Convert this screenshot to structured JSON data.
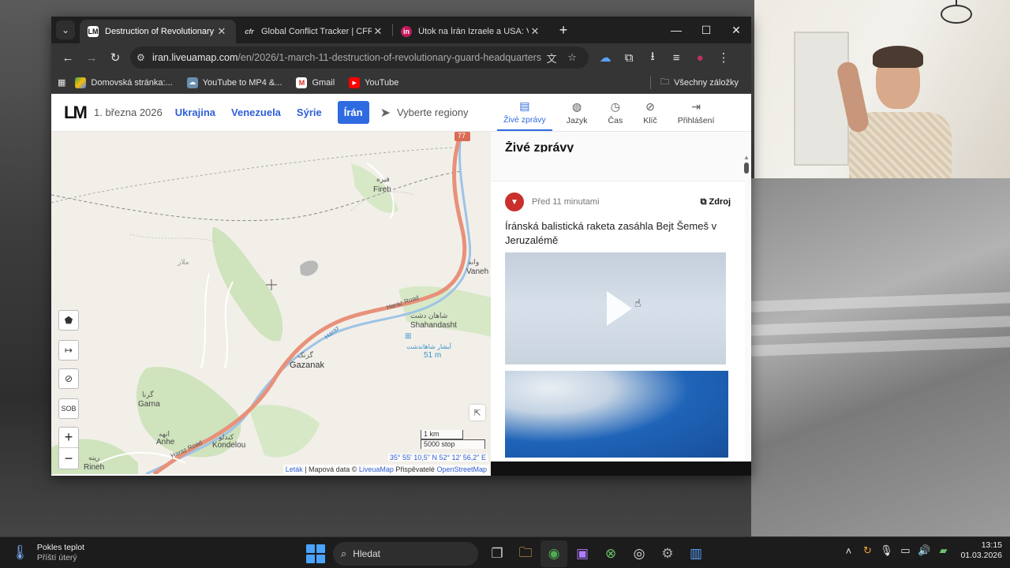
{
  "browser": {
    "tabs": [
      {
        "title": "Destruction of Revolutionary Gu",
        "favicon": "LM",
        "active": true
      },
      {
        "title": "Global Conflict Tracker | CFR Int",
        "favicon": "cfr",
        "active": false
      },
      {
        "title": "Útok na Írán Izraele a USA: Válk",
        "favicon": "in",
        "active": false
      }
    ],
    "url_host": "iran.liveuamap.com",
    "url_path": "/en/2026/1-march-11-destruction-of-revolutionary-guard-headquarters",
    "bookmarks": [
      "Domovská stránka:...",
      "YouTube to MP4 &...",
      "Gmail",
      "YouTube"
    ],
    "all_bookmarks": "Všechny záložky"
  },
  "site": {
    "logo": "LM",
    "date": "1. března 2026",
    "nav": [
      "Ukrajina",
      "Venezuela",
      "Sýrie",
      "Írán"
    ],
    "active_nav": "Írán",
    "region_placeholder": "Vyberte regiony"
  },
  "panel": {
    "tabs": [
      {
        "label": "Živé zprávy",
        "icon": "news-icon"
      },
      {
        "label": "Jazyk",
        "icon": "globe-icon"
      },
      {
        "label": "Čas",
        "icon": "clock-icon"
      },
      {
        "label": "Klíč",
        "icon": "compass-icon"
      },
      {
        "label": "Přihlášení",
        "icon": "login-icon"
      }
    ],
    "title": "Živé zprávy",
    "card": {
      "time_ago": "Před 11 minutami",
      "source": "Zdroj",
      "text": "Íránská balistická raketa zasáhla Bejt Šemeš v Jeruzalémě"
    }
  },
  "map": {
    "labels": {
      "fireh": "Fireh",
      "fireh_ar": "فيره",
      "vaneh": "Vaneh",
      "vaneh_ar": "وانه",
      "shahandasht": "Shahandasht",
      "shahandasht_ar": "شاهان دشت",
      "waterfall_ar": "آبشار شاهاندشت",
      "waterfall_height": "51 m",
      "gazanak": "Gazanak",
      "gazanak_ar": "گزنک",
      "garna": "Garna",
      "garna_ar": "گرنا",
      "anhe": "Anhe",
      "anhe_ar": "انهه",
      "kondelou": "Kondelou",
      "kondelou_ar": "کندلو",
      "rineh": "Rineh",
      "rineh_ar": "رينه",
      "malar_ar": "ملار",
      "road_77": "77",
      "road_haraz": "Haraz Road",
      "road_haraz_2": "Haraz Road",
      "river_haraz": "Haraz"
    },
    "scale_km": "1 km",
    "scale_ft": "5000 stop",
    "coords": "35° 55' 10,5\" N 52° 12' 56,2\" E",
    "attribution_leaflet": "Leták",
    "attribution_mid": "| Mapová data ©",
    "attribution_liveuamap": "LiveuaMap",
    "attribution_contrib": "Přispěvatelé",
    "attribution_osm": "OpenStreetMap",
    "controls": {
      "sob": "SOB",
      "zoom_in": "+",
      "zoom_out": "−"
    }
  },
  "taskbar": {
    "weather_title": "Pokles teplot",
    "weather_sub": "Příští úterý",
    "search": "Hledat",
    "time": "13:15",
    "date": "01.03.2026"
  },
  "colors": {
    "accent": "#2f6be0",
    "link": "#2f5fd6",
    "road": "#e8917a",
    "river": "#9ec3e6",
    "forest": "#c9dfb8"
  }
}
